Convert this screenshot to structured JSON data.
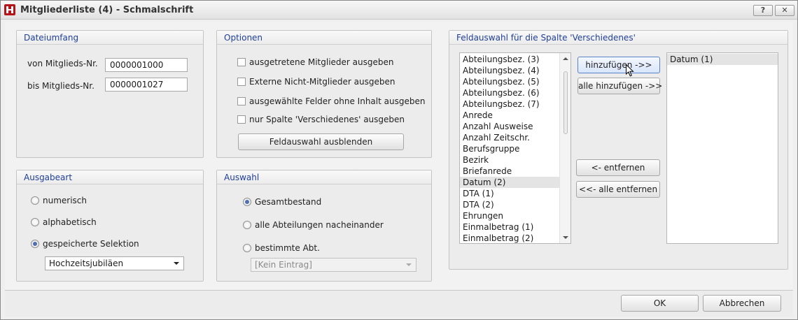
{
  "window": {
    "title": "Mitgliederliste (4) - Schmalschrift",
    "help_label": "?",
    "close_label": "✕"
  },
  "dateiumfang": {
    "title": "Dateiumfang",
    "from_label": "von Mitglieds-Nr.",
    "from_value": "0000001000",
    "to_label": "bis Mitglieds-Nr.",
    "to_value": "0000001027"
  },
  "optionen": {
    "title": "Optionen",
    "checkboxes": [
      {
        "label": "ausgetretene Mitglieder ausgeben",
        "checked": false
      },
      {
        "label": "Externe Nicht-Mitglieder ausgeben",
        "checked": false
      },
      {
        "label": "ausgewählte Felder ohne Inhalt ausgeben",
        "checked": false
      },
      {
        "label": "nur Spalte 'Verschiedenes' ausgeben",
        "checked": false
      }
    ],
    "toggle_button": "Feldauswahl ausblenden"
  },
  "ausgabeart": {
    "title": "Ausgabeart",
    "radios": [
      {
        "label": "numerisch",
        "checked": false
      },
      {
        "label": "alphabetisch",
        "checked": false
      },
      {
        "label": "gespeicherte Selektion",
        "checked": true
      }
    ],
    "selection_value": "Hochzeitsjubiläen"
  },
  "auswahl": {
    "title": "Auswahl",
    "radios": [
      {
        "label": "Gesamtbestand",
        "checked": true
      },
      {
        "label": "alle Abteilungen nacheinander",
        "checked": false
      },
      {
        "label": "bestimmte Abt.",
        "checked": false
      }
    ],
    "dept_value": "[Kein Eintrag]"
  },
  "feldauswahl": {
    "title": "Feldauswahl für die Spalte 'Verschiedenes'",
    "available": [
      "Abteilungsbez. (3)",
      "Abteilungsbez. (4)",
      "Abteilungsbez. (5)",
      "Abteilungsbez. (6)",
      "Abteilungsbez. (7)",
      "Anrede",
      "Anzahl Ausweise",
      "Anzahl Zeitschr.",
      "Berufsgruppe",
      "Bezirk",
      "Briefanrede",
      "Datum (2)",
      "DTA (1)",
      "DTA (2)",
      "Ehrungen",
      "Einmalbetrag (1)",
      "Einmalbetrag (2)"
    ],
    "selected_index": 11,
    "chosen": [
      "Datum (1)"
    ],
    "add_label": "hinzufügen ->>",
    "add_all_label": "alle hinzufügen ->>",
    "remove_label": "<- entfernen",
    "remove_all_label": "<<- alle entfernen"
  },
  "footer": {
    "ok_label": "OK",
    "cancel_label": "Abbrechen"
  }
}
